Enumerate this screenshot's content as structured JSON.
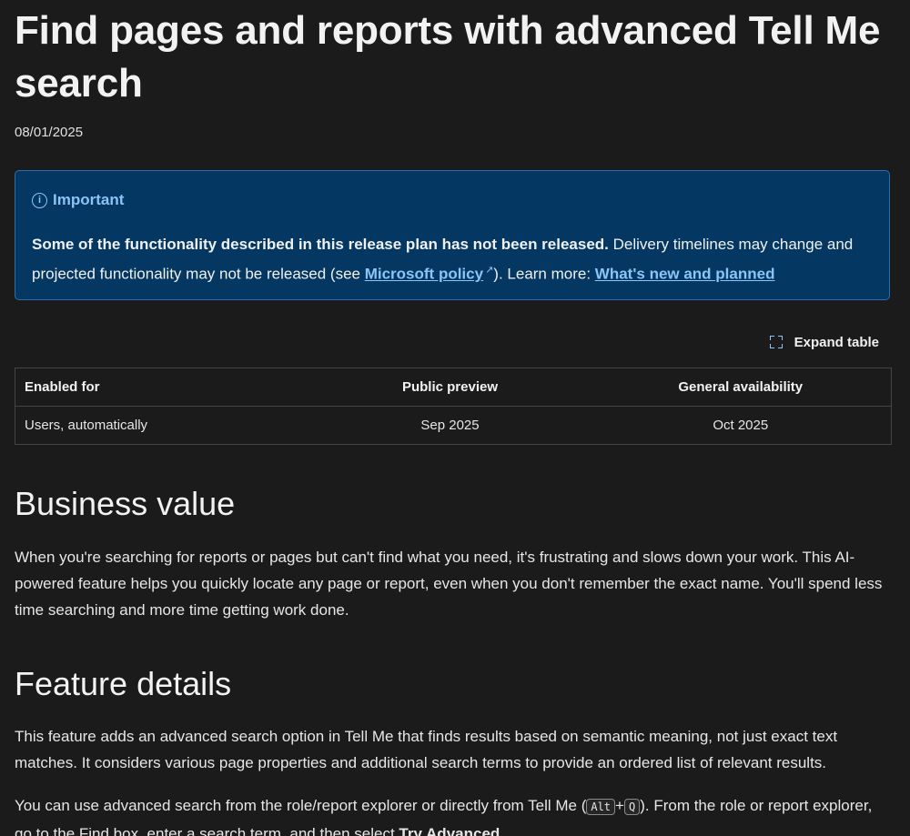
{
  "title": "Find pages and reports with advanced Tell Me search",
  "date": "08/01/2025",
  "alert": {
    "icon": "info-icon",
    "title": "Important",
    "bold_text": "Some of the functionality described in this release plan has not been released.",
    "text_1": " Delivery timelines may change and projected functionality may not be released (see ",
    "link_1": "Microsoft policy",
    "text_2": "). Learn more: ",
    "link_2": "What's new and planned"
  },
  "expand_table": {
    "label": "Expand table",
    "icon": "expand-icon"
  },
  "table": {
    "headers": [
      "Enabled for",
      "Public preview",
      "General availability"
    ],
    "rows": [
      [
        "Users, automatically",
        "Sep 2025",
        "Oct 2025"
      ]
    ]
  },
  "business_value": {
    "heading": "Business value",
    "paragraph": "When you're searching for reports or pages but can't find what you need, it's frustrating and slows down your work. This AI-powered feature helps you quickly locate any page or report, even when you don't remember the exact name. You'll spend less time searching and more time getting work done."
  },
  "feature_details": {
    "heading": "Feature details",
    "paragraph_1": "This feature adds an advanced search option in Tell Me that finds results based on semantic meaning, not just exact text matches. It considers various page properties and additional search terms to provide an ordered list of relevant results.",
    "paragraph_2_a": "You can use advanced search from the role/report explorer or directly from Tell Me (",
    "key_1": "Alt",
    "key_sep": "+",
    "key_2": "Q",
    "paragraph_2_b": "). From the role or report explorer, go to the Find box, enter a search term, and then select ",
    "paragraph_2_bold": "Try Advanced",
    "paragraph_2_c": "."
  }
}
